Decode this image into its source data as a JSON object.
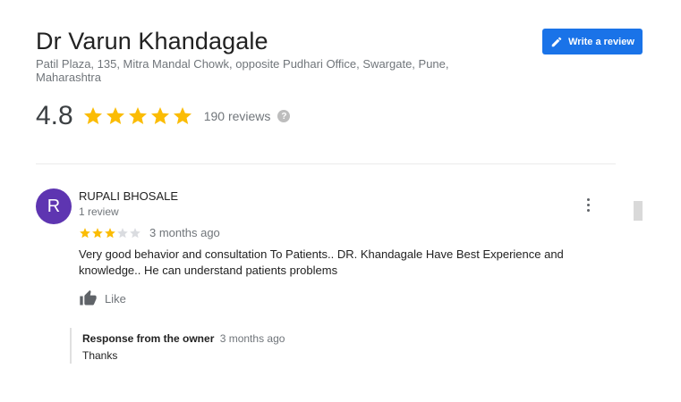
{
  "place": {
    "name": "Dr Varun Khandagale",
    "address": "Patil Plaza, 135, Mitra Mandal Chowk, opposite Pudhari Office, Swargate, Pune, Maharashtra",
    "rating": "4.8",
    "stars_filled": 5,
    "review_count_label": "190 reviews",
    "help_icon": "?"
  },
  "actions": {
    "write_review_label": "Write a review"
  },
  "review": {
    "avatar_letter": "R",
    "avatar_color": "#5e35b1",
    "reviewer_name": "RUPALI BHOSALE",
    "reviewer_meta": "1 review",
    "stars": 3,
    "date": "3 months ago",
    "text": "Very good behavior and consultation To Patients.. DR. Khandagale Have Best Experience and knowledge.. He can understand patients problems",
    "like_label": "Like",
    "owner_response": {
      "title": "Response from the owner",
      "date": "3 months ago",
      "text": "Thanks"
    }
  },
  "colors": {
    "star_filled": "#fbbc04",
    "star_empty": "#dadce0",
    "accent": "#1a73e8"
  }
}
